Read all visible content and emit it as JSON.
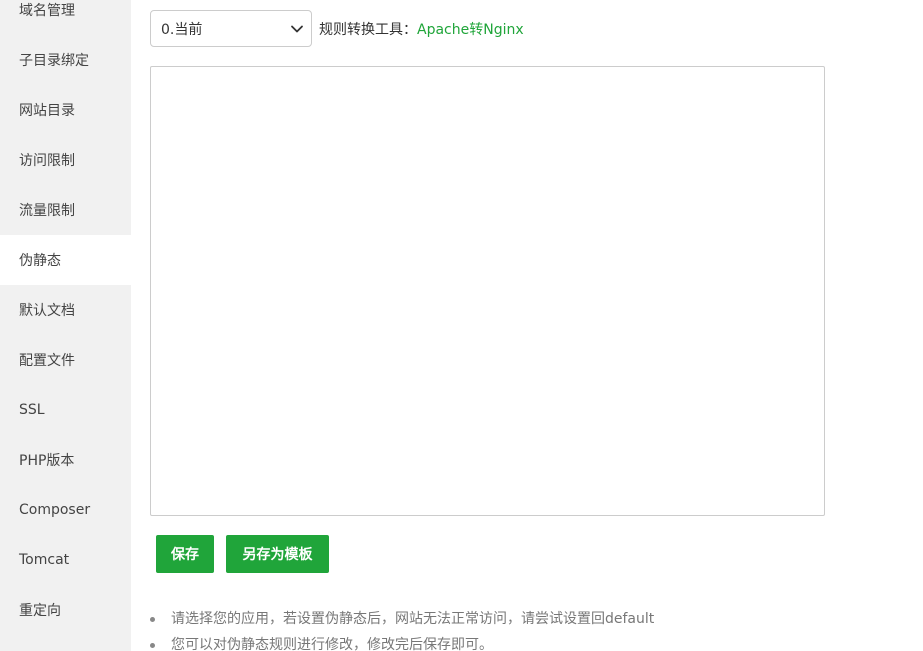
{
  "sidebar": {
    "items": [
      {
        "label": "域名管理"
      },
      {
        "label": "子目录绑定"
      },
      {
        "label": "网站目录"
      },
      {
        "label": "访问限制"
      },
      {
        "label": "流量限制"
      },
      {
        "label": "伪静态",
        "active": true
      },
      {
        "label": "默认文档"
      },
      {
        "label": "配置文件"
      },
      {
        "label": "SSL"
      },
      {
        "label": "PHP版本"
      },
      {
        "label": "Composer"
      },
      {
        "label": "Tomcat"
      },
      {
        "label": "重定向"
      }
    ]
  },
  "rewrite": {
    "select_value": "0.当前",
    "tool_label": "规则转换工具：",
    "tool_link": "Apache转Nginx",
    "editor_value": ""
  },
  "buttons": {
    "save": "保存",
    "save_as_template": "另存为模板"
  },
  "tips": [
    "请选择您的应用，若设置伪静态后，网站无法正常访问，请尝试设置回default",
    "您可以对伪静态规则进行修改，修改完后保存即可。"
  ],
  "colors": {
    "accent": "#20a53a",
    "sidebar_bg": "#f1f1f1",
    "border": "#cccccc"
  }
}
